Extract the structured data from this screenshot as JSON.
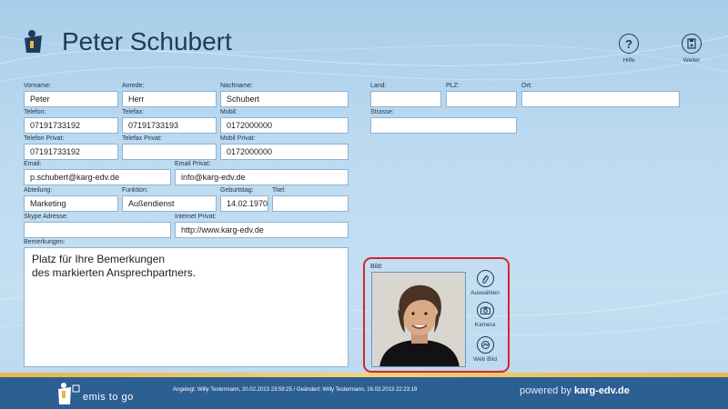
{
  "header": {
    "title": "Peter Schubert",
    "help_label": "Hilfe",
    "next_label": "Weiter"
  },
  "fields": {
    "vorname": {
      "label": "Vorname:",
      "value": "Peter"
    },
    "anrede": {
      "label": "Anrede:",
      "value": "Herr"
    },
    "nachname": {
      "label": "Nachname:",
      "value": "Schubert"
    },
    "telefon": {
      "label": "Telefon:",
      "value": "07191733192"
    },
    "telefax": {
      "label": "Telefax:",
      "value": "07191733193"
    },
    "mobil": {
      "label": "Mobil:",
      "value": "0172000000"
    },
    "telefon_privat": {
      "label": "Telefon Privat:",
      "value": "07191733192"
    },
    "telefax_privat": {
      "label": "Telefax Privat:",
      "value": ""
    },
    "mobil_privat": {
      "label": "Mobil Privat:",
      "value": "0172000000"
    },
    "email": {
      "label": "Email:",
      "value": "p.schubert@karg-edv.de"
    },
    "email_privat": {
      "label": "Email Privat:",
      "value": "info@karg-edv.de"
    },
    "abteilung": {
      "label": "Abteilung:",
      "value": "Marketing"
    },
    "funktion": {
      "label": "Funktion:",
      "value": "Außendienst"
    },
    "geburtstag": {
      "label": "Geburtstag:",
      "value": "14.02.1970"
    },
    "titel": {
      "label": "Titel:",
      "value": ""
    },
    "skype": {
      "label": "Skype Adresse:",
      "value": ""
    },
    "internet_privat": {
      "label": "Internet Privat:",
      "value": "http://www.karg-edv.de"
    },
    "land": {
      "label": "Land:",
      "value": ""
    },
    "plz": {
      "label": "PLZ:",
      "value": ""
    },
    "ort": {
      "label": "Ort:",
      "value": ""
    },
    "strasse": {
      "label": "Strasse:",
      "value": ""
    }
  },
  "notes": {
    "label": "Bemerkungen:",
    "line1": "Platz für Ihre Bemerkungen",
    "line2": "des markierten Ansprechpartners."
  },
  "picture": {
    "label": "Bild:",
    "select_label": "Auswählen",
    "camera_label": "Kamera",
    "web_label": "Web Bild"
  },
  "footer": {
    "brand": "emis to go",
    "status": "Angelegt: Willy Testermann, 20.02.2013 23:59:25  /  Geändert: Willy Testermann, 16.03.2013 22:23:19",
    "powered_prefix": "powered by ",
    "powered_brand": "karg-edv.de"
  },
  "colors": {
    "background": "#bcdaf0",
    "footer": "#2c5f92",
    "footer_stripe": "#e7b54d",
    "highlight": "#d8232a"
  }
}
